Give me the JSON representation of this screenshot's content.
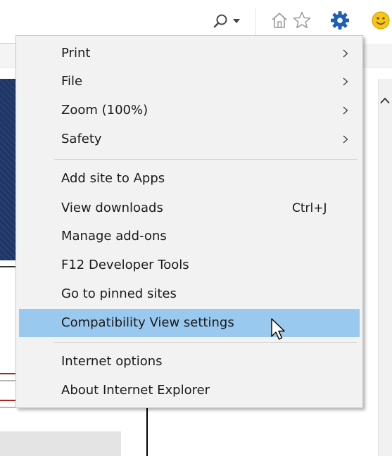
{
  "toolbar": {
    "icons": [
      "search-icon",
      "dropdown-arrow-icon",
      "home-icon",
      "favorites-star-icon",
      "tools-gear-icon",
      "smiley-feedback-icon"
    ],
    "colors": {
      "gear": "#1e5fb3",
      "smiley": "#f5c518",
      "outline_icon": "#9a9a9a"
    }
  },
  "menu": {
    "items": [
      {
        "label": "Print",
        "has_submenu": true
      },
      {
        "label": "File",
        "has_submenu": true
      },
      {
        "label": "Zoom (100%)",
        "has_submenu": true
      },
      {
        "label": "Safety",
        "has_submenu": true
      },
      {
        "label": "Add site to Apps",
        "has_submenu": false
      },
      {
        "label": "View downloads",
        "shortcut": "Ctrl+J",
        "has_submenu": false
      },
      {
        "label": "Manage add-ons",
        "has_submenu": false
      },
      {
        "label": "F12 Developer Tools",
        "has_submenu": false
      },
      {
        "label": "Go to pinned sites",
        "has_submenu": false
      },
      {
        "label": "Compatibility View settings",
        "has_submenu": false,
        "highlighted": true
      },
      {
        "label": "Internet options",
        "has_submenu": false
      },
      {
        "label": "About Internet Explorer",
        "has_submenu": false
      }
    ],
    "colors": {
      "background": "#f2f2f2",
      "highlight": "#99c9ef",
      "text": "#1a1a1a"
    }
  },
  "page": {
    "banner_color": "#1e3566",
    "accent_red": "#b32020"
  }
}
